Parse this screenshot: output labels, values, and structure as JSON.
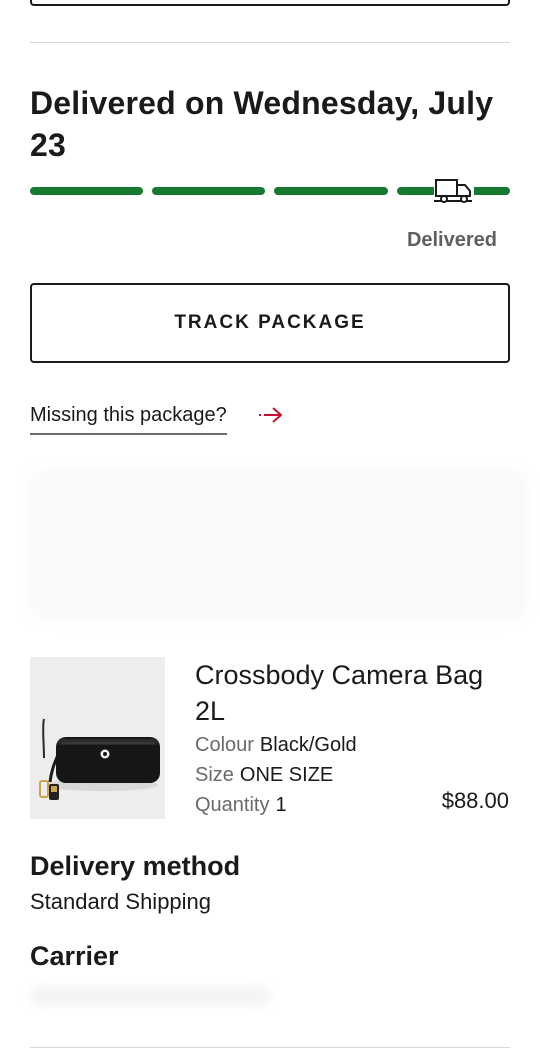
{
  "delivery_status": {
    "heading": "Delivered on Wednesday, July 23",
    "progress_label": "Delivered",
    "progress_steps_total": 4,
    "progress_steps_complete": 4,
    "progress_color": "#167a30"
  },
  "actions": {
    "track_package_label": "TRACK PACKAGE",
    "missing_package_label": "Missing this package?",
    "missing_package_icon": "arrow-right-icon",
    "accent_color": "#c8102e"
  },
  "item": {
    "name": "Crossbody Camera Bag 2L",
    "colour_label": "Colour",
    "colour_value": "Black/Gold",
    "size_label": "Size",
    "size_value": "ONE SIZE",
    "quantity_label": "Quantity",
    "quantity_value": "1",
    "price": "$88.00"
  },
  "delivery": {
    "method_title": "Delivery method",
    "method_value": "Standard Shipping",
    "carrier_title": "Carrier"
  }
}
